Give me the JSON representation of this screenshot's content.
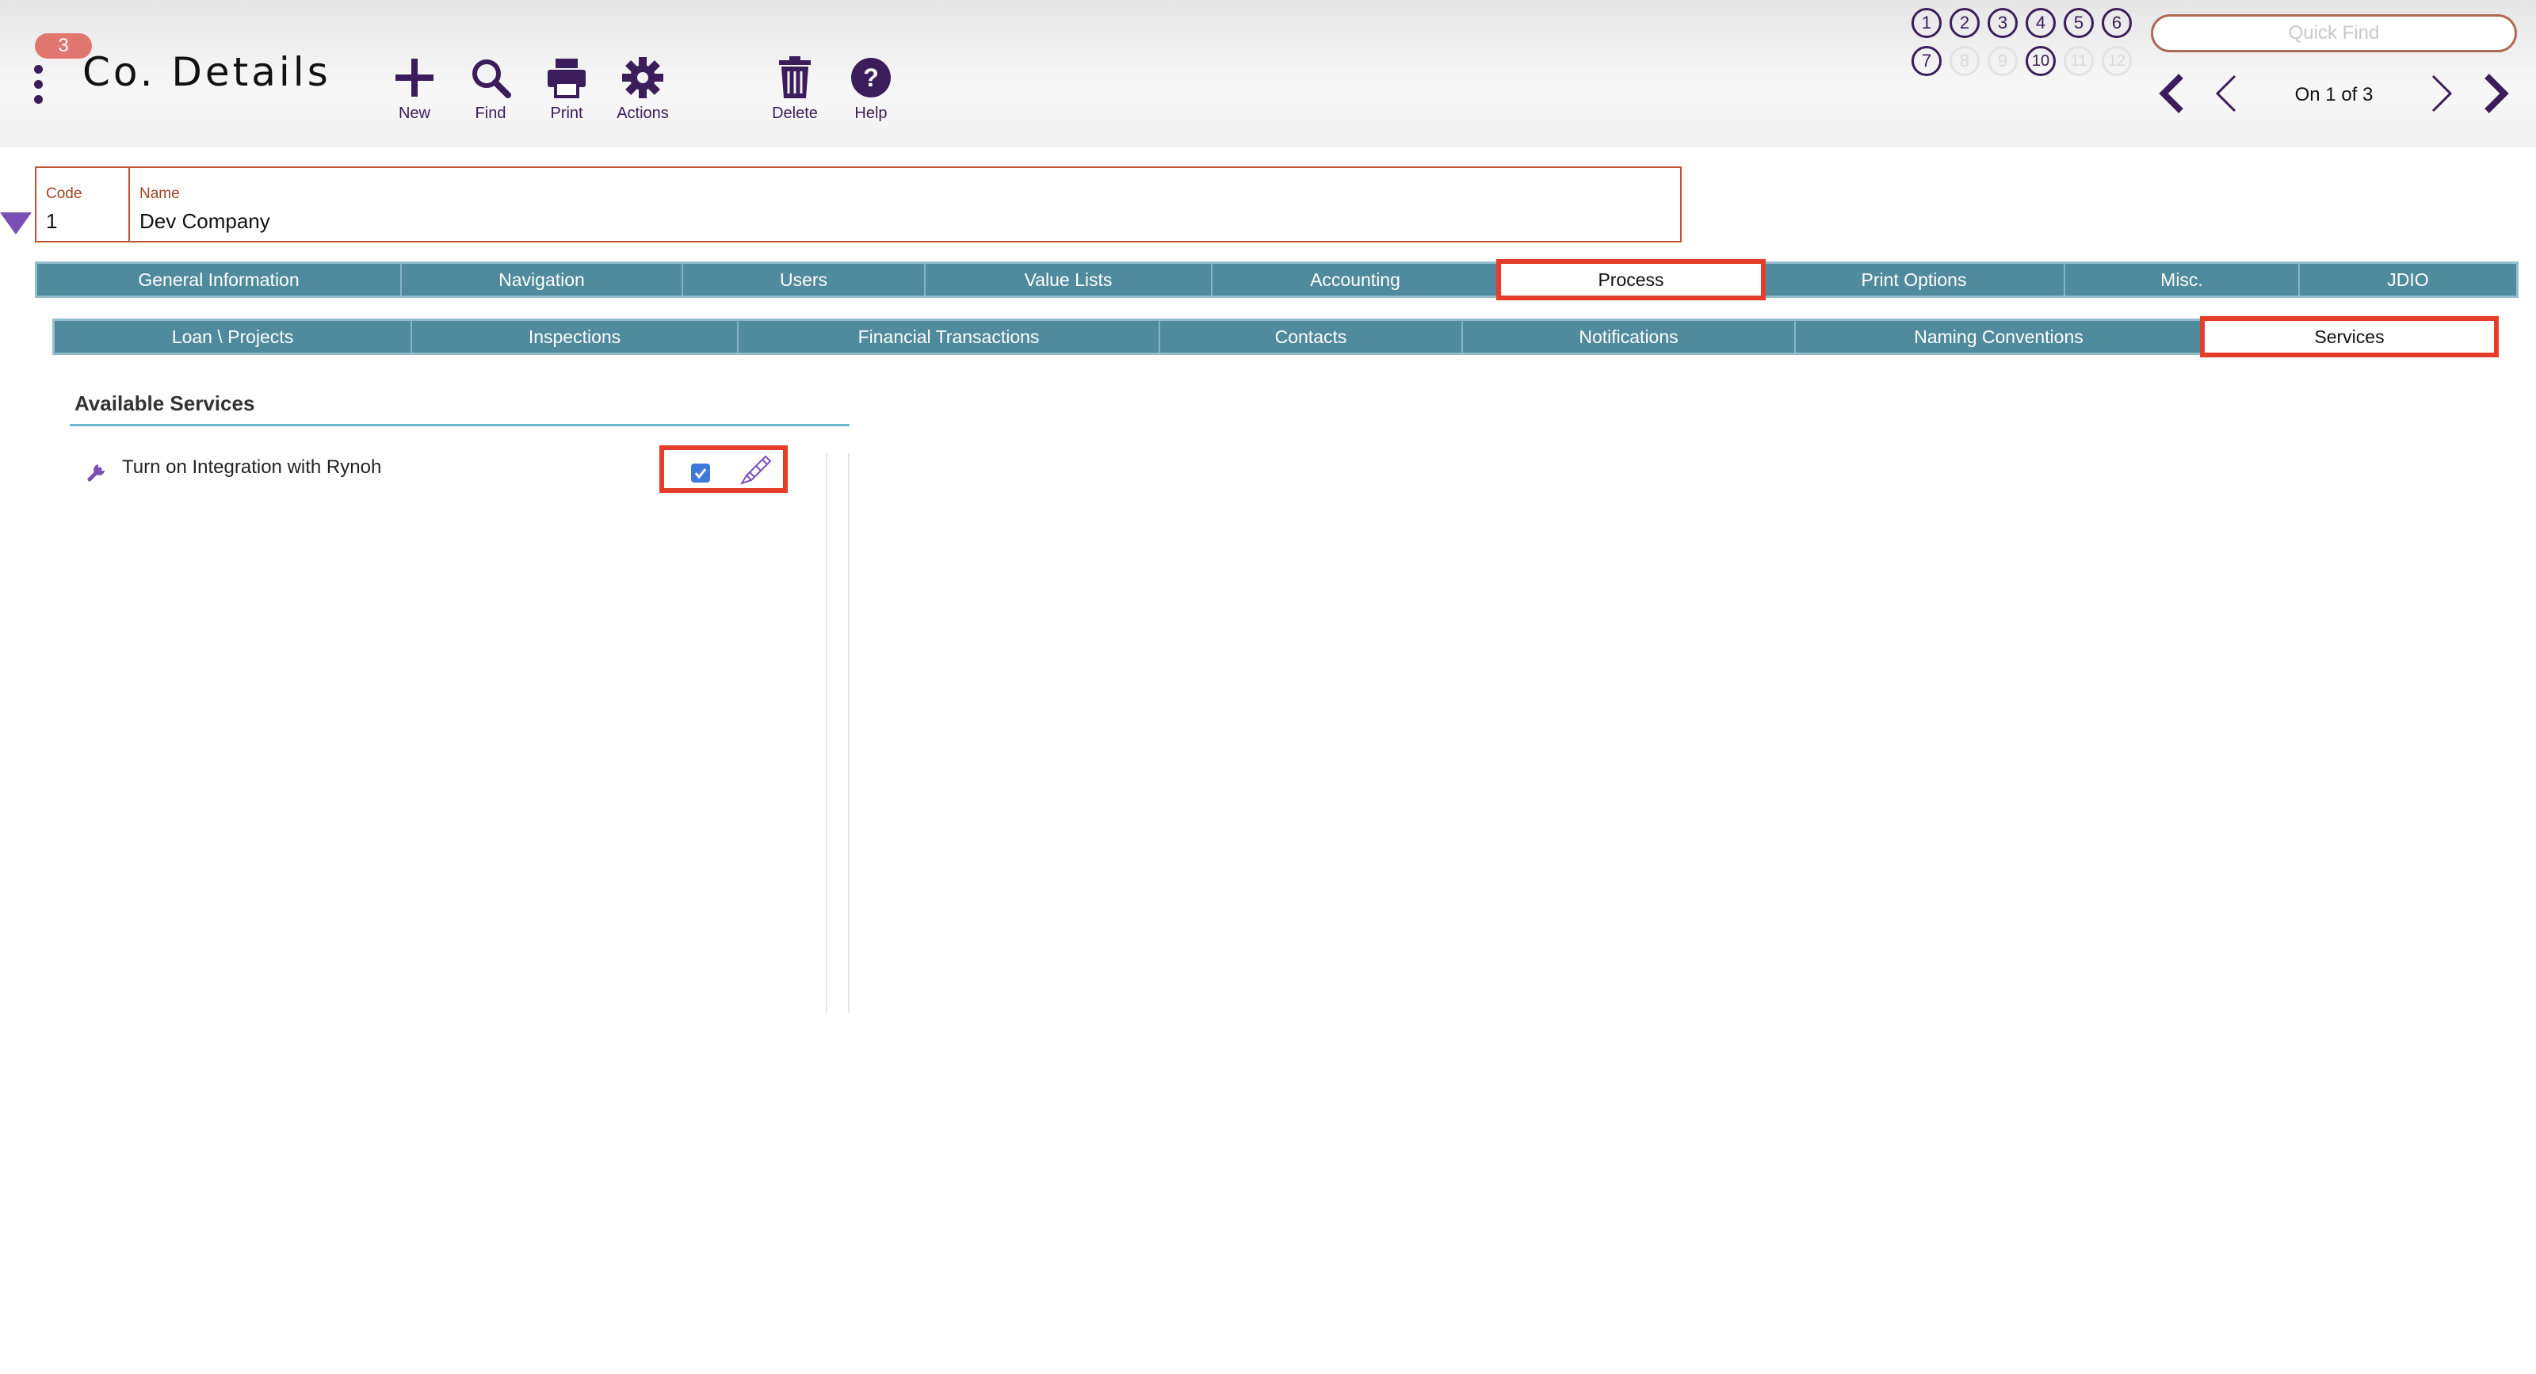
{
  "header": {
    "badge_count": "3",
    "title": "Co. Details",
    "toolbar": {
      "new": "New",
      "find": "Find",
      "print": "Print",
      "actions": "Actions",
      "delete": "Delete",
      "help": "Help"
    },
    "layout_buttons_row1": [
      "1",
      "2",
      "3",
      "4",
      "5",
      "6"
    ],
    "layout_buttons_row2": [
      "7",
      "8",
      "9",
      "10",
      "11",
      "12"
    ],
    "quick_find_placeholder": "Quick Find",
    "record_count": "On 1 of 3"
  },
  "record": {
    "code_label": "Code",
    "code_value": "1",
    "name_label": "Name",
    "name_value": "Dev Company"
  },
  "main_tabs": [
    {
      "label": "General Information"
    },
    {
      "label": "Navigation"
    },
    {
      "label": "Users"
    },
    {
      "label": "Value Lists"
    },
    {
      "label": "Accounting"
    },
    {
      "label": "Process"
    },
    {
      "label": "Print Options"
    },
    {
      "label": "Misc."
    },
    {
      "label": "JDIO"
    }
  ],
  "sub_tabs": [
    {
      "label": "Loan \\ Projects"
    },
    {
      "label": "Inspections"
    },
    {
      "label": "Financial Transactions"
    },
    {
      "label": "Contacts"
    },
    {
      "label": "Notifications"
    },
    {
      "label": "Naming Conventions"
    },
    {
      "label": "Services"
    }
  ],
  "content": {
    "section_title": "Available Services",
    "services": [
      {
        "label": "Turn on Integration with Rynoh",
        "enabled": true
      }
    ]
  },
  "colors": {
    "accent": "#3a1d5a",
    "tab_bg": "#4f8b9c",
    "highlight": "#e53d2a",
    "badge": "#e0766f",
    "field_border": "#c0532f"
  }
}
